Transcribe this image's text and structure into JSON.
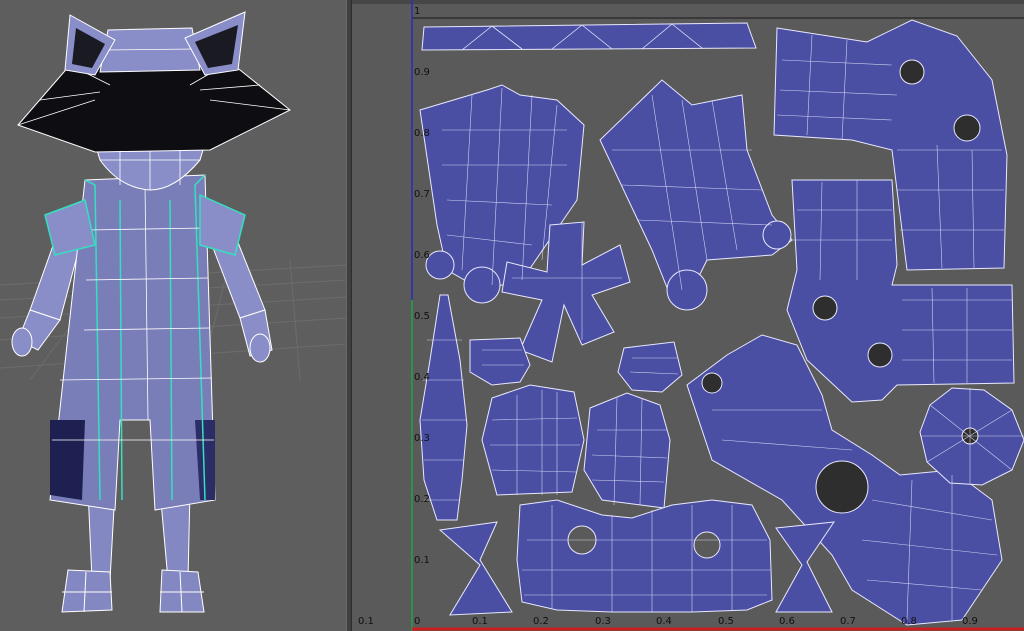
{
  "viewport": {
    "name": "perspective-view"
  },
  "uv_editor": {
    "v_ticks": [
      {
        "label": "1"
      },
      {
        "label": "0.9"
      },
      {
        "label": "0.8"
      },
      {
        "label": "0.7"
      },
      {
        "label": "0.6"
      },
      {
        "label": "0.5"
      },
      {
        "label": "0.4"
      },
      {
        "label": "0.3"
      },
      {
        "label": "0.2"
      },
      {
        "label": "0.1"
      }
    ],
    "u_ticks": [
      {
        "label": "0.1"
      },
      {
        "label": "0"
      },
      {
        "label": "0.1"
      },
      {
        "label": "0.2"
      },
      {
        "label": "0.3"
      },
      {
        "label": "0.4"
      },
      {
        "label": "0.5"
      },
      {
        "label": "0.6"
      },
      {
        "label": "0.7"
      },
      {
        "label": "0.8"
      },
      {
        "label": "0.9"
      }
    ]
  },
  "colors": {
    "uv_fill": "#4a4fa3",
    "uv_wire": "#e8e8ff",
    "model_fill": "#7c80b8",
    "selection": "#35e0c0",
    "grid_bg": "#575757"
  }
}
